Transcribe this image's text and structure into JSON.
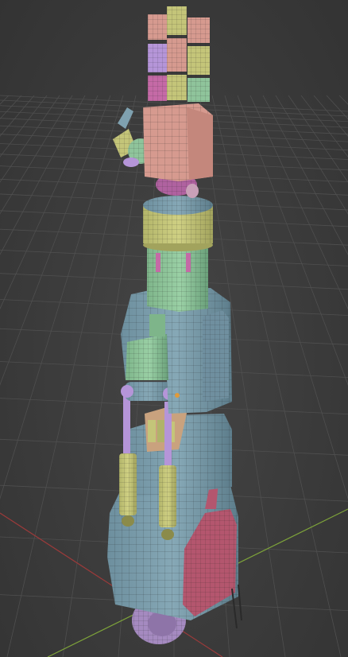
{
  "viewport": {
    "label": "",
    "background": "#3d3d3d",
    "grid_color": "#4f4f4f",
    "x_axis_color": "#9b3a3a",
    "y_axis_color": "#7da23a"
  },
  "model": {
    "name": "",
    "palette": {
      "pink": "#d69a8f",
      "lilac": "#b595d8",
      "magenta": "#c56aa6",
      "olive": "#c4c579",
      "green": "#8fc49b",
      "steel": "#7fa1b0",
      "crimson": "#b4566e",
      "wire": "#2a2a2a"
    }
  }
}
